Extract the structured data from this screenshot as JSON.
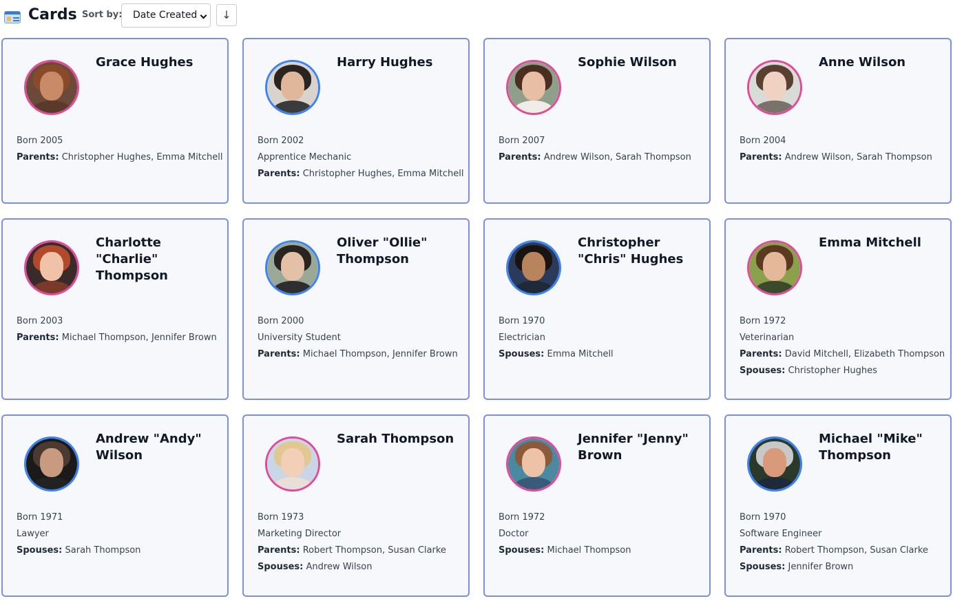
{
  "header": {
    "title": "Cards",
    "sort_label": "Sort by:",
    "sort_selected": "Date Created",
    "sort_direction_symbol": "↓",
    "icon": "id-card-icon"
  },
  "labels": {
    "parents": "Parents:",
    "spouses": "Spouses:"
  },
  "cards": [
    {
      "name": "Grace Hughes",
      "born": "Born 2005",
      "occupation": "",
      "parents": "Christopher Hughes, Emma Mitchell",
      "spouses": "",
      "gender": "female",
      "colors": {
        "bg": "#6b4a3a",
        "hair": "#8a4a2a",
        "skin": "#c98a68",
        "shirt": "#5a3a2a"
      }
    },
    {
      "name": "Harry Hughes",
      "born": "Born 2002",
      "occupation": "Apprentice Mechanic",
      "parents": "Christopher Hughes, Emma Mitchell",
      "spouses": "",
      "gender": "male",
      "colors": {
        "bg": "#d8d4cc",
        "hair": "#2a2420",
        "skin": "#e1b79c",
        "shirt": "#3b3b3b"
      }
    },
    {
      "name": "Sophie Wilson",
      "born": "Born 2007",
      "occupation": "",
      "parents": "Andrew Wilson, Sarah Thompson",
      "spouses": "",
      "gender": "female",
      "colors": {
        "bg": "#8fa08a",
        "hair": "#4a2e20",
        "skin": "#e8bfa4",
        "shirt": "#f0ece6"
      }
    },
    {
      "name": "Anne Wilson",
      "born": "Born 2004",
      "occupation": "",
      "parents": "Andrew Wilson, Sarah Thompson",
      "spouses": "",
      "gender": "female",
      "colors": {
        "bg": "#d8dcd6",
        "hair": "#5a4030",
        "skin": "#efd2c2",
        "shirt": "#7a7268"
      }
    },
    {
      "name": "Charlotte \"Charlie\" Thompson",
      "born": "Born 2003",
      "occupation": "",
      "parents": "Michael Thompson, Jennifer Brown",
      "spouses": "",
      "gender": "female",
      "colors": {
        "bg": "#3a2a2a",
        "hair": "#b04a2a",
        "skin": "#f0c2a8",
        "shirt": "#7a3a2a"
      }
    },
    {
      "name": "Oliver \"Ollie\" Thompson",
      "born": "Born 2000",
      "occupation": "University Student",
      "parents": "Michael Thompson, Jennifer Brown",
      "spouses": "",
      "gender": "male",
      "colors": {
        "bg": "#9aa898",
        "hair": "#2a2420",
        "skin": "#e4c0a6",
        "shirt": "#2e2e2e"
      }
    },
    {
      "name": "Christopher \"Chris\" Hughes",
      "born": "Born 1970",
      "occupation": "Electrician",
      "parents": "",
      "spouses": "Emma Mitchell",
      "gender": "male",
      "colors": {
        "bg": "#2a3a5a",
        "hair": "#1a1410",
        "skin": "#b8845e",
        "shirt": "#1e2a3a"
      }
    },
    {
      "name": "Emma Mitchell",
      "born": "Born 1972",
      "occupation": "Veterinarian",
      "parents": "David Mitchell, Elizabeth Thompson",
      "spouses": "Christopher Hughes",
      "gender": "female",
      "colors": {
        "bg": "#8aa04a",
        "hair": "#5a3a20",
        "skin": "#e4b898",
        "shirt": "#3a4a2a"
      }
    },
    {
      "name": "Andrew \"Andy\" Wilson",
      "born": "Born 1971",
      "occupation": "Lawyer",
      "parents": "",
      "spouses": "Sarah Thompson",
      "gender": "male",
      "colors": {
        "bg": "#1a1a1a",
        "hair": "#4a3a30",
        "skin": "#c89a80",
        "shirt": "#222222"
      }
    },
    {
      "name": "Sarah Thompson",
      "born": "Born 1973",
      "occupation": "Marketing Director",
      "parents": "Robert Thompson, Susan Clarke",
      "spouses": "Andrew Wilson",
      "gender": "female",
      "colors": {
        "bg": "#c8d6e6",
        "hair": "#e0c890",
        "skin": "#f2d0b8",
        "shirt": "#e8e0d8"
      }
    },
    {
      "name": "Jennifer \"Jenny\" Brown",
      "born": "Born 1972",
      "occupation": "Doctor",
      "parents": "",
      "spouses": "Michael Thompson",
      "gender": "female",
      "colors": {
        "bg": "#4a8aa0",
        "hair": "#8a5a3a",
        "skin": "#eec2a6",
        "shirt": "#3a5a7a"
      }
    },
    {
      "name": "Michael \"Mike\" Thompson",
      "born": "Born 1970",
      "occupation": "Software Engineer",
      "parents": "Robert Thompson, Susan Clarke",
      "spouses": "Jennifer Brown",
      "gender": "male",
      "colors": {
        "bg": "#2a3a2a",
        "hair": "#c8c8c8",
        "skin": "#d89a7a",
        "shirt": "#1e2a3a"
      }
    }
  ]
}
